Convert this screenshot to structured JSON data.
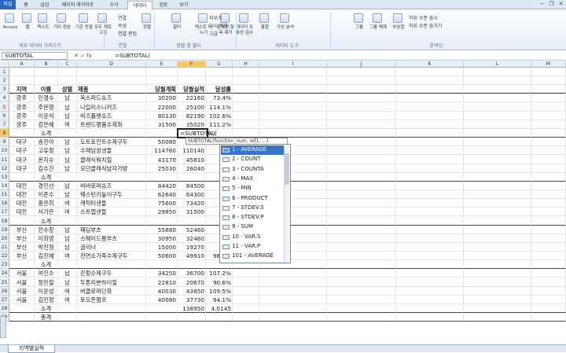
{
  "tabs": [
    "파일",
    "홈",
    "삽입",
    "페이지 레이아웃",
    "수식",
    "데이터",
    "검토",
    "보기"
  ],
  "active_tab": "데이터",
  "ribbon": {
    "items": [
      {
        "icon": "access-icon",
        "label": "Access"
      },
      {
        "icon": "web-icon",
        "label": "웹"
      },
      {
        "icon": "text-icon",
        "label": "텍스트"
      },
      {
        "icon": "other-source-icon",
        "label": "기타 원본"
      },
      {
        "icon": "existing-connection-icon",
        "label": "기존 연결"
      },
      {
        "icon": "refresh-icon",
        "label": "모두 새로 고침"
      },
      {
        "icon": "sort-az-icon",
        "label": "정렬"
      },
      {
        "icon": "filter-icon",
        "label": "필터"
      },
      {
        "icon": "text-split-icon",
        "label": "텍스트 나누기"
      },
      {
        "icon": "remove-dup-icon",
        "label": "중복된 항목 제거"
      },
      {
        "icon": "validation-icon",
        "label": "데이터 유효성 검사"
      },
      {
        "icon": "consolidate-icon",
        "label": "통합"
      },
      {
        "icon": "whatif-icon",
        "label": "가상 분석"
      },
      {
        "icon": "group-icon",
        "label": "그룹"
      },
      {
        "icon": "ungroup-icon",
        "label": "그룹 해제"
      },
      {
        "icon": "subtotal-icon",
        "label": "부분합"
      }
    ],
    "small": [
      "연결",
      "속성",
      "연결 편집",
      "지우기",
      "다시 적용",
      "고급",
      "하위 수준 표시",
      "하위 수준 숨기기"
    ],
    "groups": [
      "외부 데이터 가져오기",
      "연결",
      "정렬 및 필터",
      "데이터 도구",
      "윤곽선"
    ]
  },
  "namebox": "SUBTOTAL",
  "fx_symbols": "✕ ✓ fx",
  "formula": "=SUBTOTAL(",
  "columns": [
    "A",
    "B",
    "C",
    "D",
    "E",
    "F",
    "G",
    "H",
    "I",
    "J",
    "K",
    "L",
    "M"
  ],
  "rows": [
    {
      "n": "1",
      "c": []
    },
    {
      "n": "2",
      "c": []
    },
    {
      "n": "3",
      "type": "hdr",
      "c": [
        "지역",
        "이름",
        "성별",
        "제품",
        "당월계획",
        "당월실적",
        "달성률"
      ]
    },
    {
      "n": "4",
      "c": [
        "광주",
        "민경수",
        "남",
        "옥스퍼드슈즈",
        "30200",
        "22160",
        "73.4%"
      ]
    },
    {
      "n": "5",
      "c": [
        "광주",
        "주은영",
        "남",
        "나일리스니커즈",
        "22000",
        "25100",
        "114.1%"
      ]
    },
    {
      "n": "6",
      "c": [
        "광주",
        "이윤석",
        "남",
        "비즈플랫슈즈",
        "80130",
        "82190",
        "102.6%"
      ]
    },
    {
      "n": "7",
      "c": [
        "광주",
        "강은혜",
        "여",
        "트랜드명품수제화",
        "31500",
        "35020",
        "111.2%"
      ]
    },
    {
      "n": "8",
      "type": "sub",
      "c": [
        "",
        "소계",
        "",
        "",
        "",
        "=SUBTOTAL(",
        ""
      ]
    },
    {
      "n": "9",
      "c": [
        "대구",
        "송진아",
        "남",
        "도트포인트수제구두",
        "50080",
        "",
        ""
      ]
    },
    {
      "n": "10",
      "c": [
        "대구",
        "고유정",
        "남",
        "수제남성샌들",
        "114760",
        "110140",
        ""
      ]
    },
    {
      "n": "11",
      "c": [
        "대구",
        "온지수",
        "남",
        "클래식워치힐",
        "43170",
        "45810",
        ""
      ]
    },
    {
      "n": "12",
      "c": [
        "대구",
        "김수진",
        "남",
        "모던클래식남자가방",
        "25030",
        "26040",
        ""
      ]
    },
    {
      "n": "13",
      "type": "sub",
      "c": [
        "",
        "소계",
        "",
        "",
        "",
        "",
        ""
      ]
    },
    {
      "n": "14",
      "c": [
        "대전",
        "경인선",
        "남",
        "비비로퍼슈즈",
        "84420",
        "84500",
        ""
      ]
    },
    {
      "n": "15",
      "c": [
        "대전",
        "이준수",
        "남",
        "웨스턴키높이구두",
        "62640",
        "64300",
        ""
      ]
    },
    {
      "n": "16",
      "c": [
        "대전",
        "홍은희",
        "여",
        "캐릭터샌들",
        "75600",
        "73420",
        ""
      ]
    },
    {
      "n": "17",
      "c": [
        "대전",
        "서가은",
        "여",
        "스트랩샌들",
        "29850",
        "31500",
        ""
      ]
    },
    {
      "n": "18",
      "type": "sub",
      "c": [
        "",
        "소계",
        "",
        "",
        "",
        "",
        ""
      ]
    },
    {
      "n": "19",
      "c": [
        "부산",
        "전수창",
        "남",
        "패딩부츠",
        "55880",
        "52460",
        ""
      ]
    },
    {
      "n": "20",
      "c": [
        "부산",
        "이희영",
        "남",
        "스웨이드롱부츠",
        "30950",
        "32460",
        ""
      ]
    },
    {
      "n": "21",
      "c": [
        "부산",
        "박진형",
        "남",
        "글리너",
        "15000",
        "19270",
        ""
      ]
    },
    {
      "n": "22",
      "c": [
        "부산",
        "김진혜",
        "여",
        "천연소가죽수제구두",
        "50600",
        "49910",
        "98.6%"
      ]
    },
    {
      "n": "23",
      "type": "sub",
      "c": [
        "",
        "소계",
        "",
        "",
        "",
        "",
        ""
      ]
    },
    {
      "n": "24",
      "c": [
        "서울",
        "여진수",
        "남",
        "끈펑수제구두",
        "34250",
        "36700",
        "107.2%"
      ]
    },
    {
      "n": "25",
      "c": [
        "서울",
        "정민철",
        "남",
        "두톤리본하이힐",
        "22810",
        "20670",
        "90.6%"
      ]
    },
    {
      "n": "26",
      "c": [
        "서울",
        "이운성",
        "여",
        "버클로퍼단화",
        "40030",
        "43850",
        "109.5%"
      ]
    },
    {
      "n": "27",
      "c": [
        "서울",
        "김민정",
        "여",
        "토오픈펌프",
        "40080",
        "37730",
        "94.1%"
      ]
    },
    {
      "n": "28",
      "type": "sub",
      "c": [
        "",
        "소계",
        "",
        "",
        "",
        "138950",
        "4.0145"
      ]
    },
    {
      "n": "29",
      "type": "sub",
      "c": [
        "",
        "총계",
        "",
        "",
        "",
        "",
        ""
      ]
    }
  ],
  "tooltip": "SUBTOTAL(function_num, ref1, ...)",
  "autocomplete": [
    "1 - AVERAGE",
    "2 - COUNT",
    "3 - COUNTA",
    "4 - MAX",
    "5 - MIN",
    "6 - PRODUCT",
    "7 - STDEV.S",
    "8 - STDEV.P",
    "9 - SUM",
    "10 - VAR.S",
    "11 - VAR.P",
    "101 - AVERAGE"
  ],
  "selected_index": 0,
  "sheet_tab": "지역별실적"
}
